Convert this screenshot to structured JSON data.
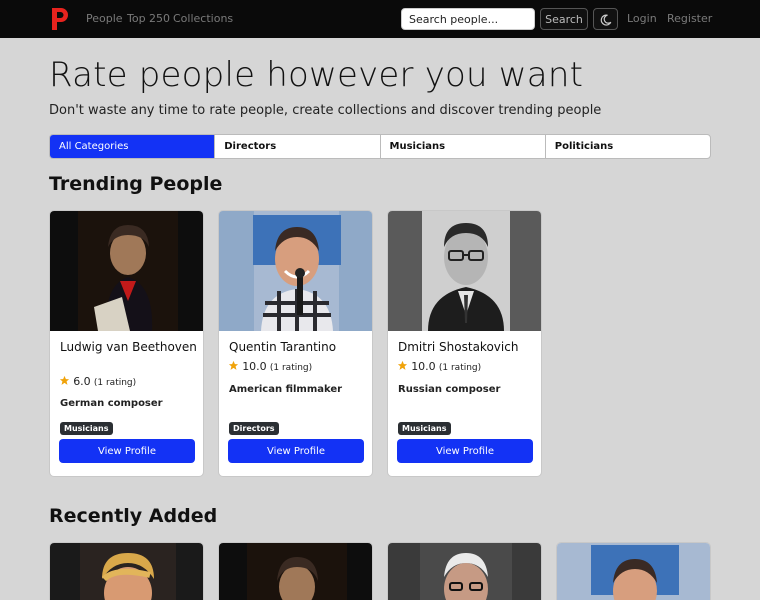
{
  "colors": {
    "accent": "#1332f5",
    "navbar": "#0a0a0a",
    "logo": "#e8231e",
    "star": "#f0a30a",
    "badge": "#2b2f33"
  },
  "navbar": {
    "logo_icon": "p-logo-icon",
    "links": [
      "People",
      "Top 250",
      "Collections"
    ],
    "search_placeholder": "Search people...",
    "search_button": "Search",
    "theme_icon": "moon-icon",
    "login": "Login",
    "register": "Register"
  },
  "hero": {
    "title": "Rate people however you want",
    "subtitle": "Don't waste any time to rate people, create collections and discover trending people"
  },
  "tabs": [
    {
      "label": "All Categories",
      "active": true
    },
    {
      "label": "Directors",
      "active": false
    },
    {
      "label": "Musicians",
      "active": false
    },
    {
      "label": "Politicians",
      "active": false
    }
  ],
  "trending": {
    "title": "Trending People",
    "cards": [
      {
        "name": "Ludwig van Beethoven",
        "score": "6.0",
        "ratings": "(1 rating)",
        "description": "German composer",
        "category": "Musicians",
        "button": "View Profile"
      },
      {
        "name": "Quentin Tarantino",
        "score": "10.0",
        "ratings": "(1 rating)",
        "description": "American filmmaker",
        "category": "Directors",
        "button": "View Profile"
      },
      {
        "name": "Dmitri Shostakovich",
        "score": "10.0",
        "ratings": "(1 rating)",
        "description": "Russian composer",
        "category": "Musicians",
        "button": "View Profile"
      }
    ]
  },
  "recent": {
    "title": "Recently Added"
  }
}
